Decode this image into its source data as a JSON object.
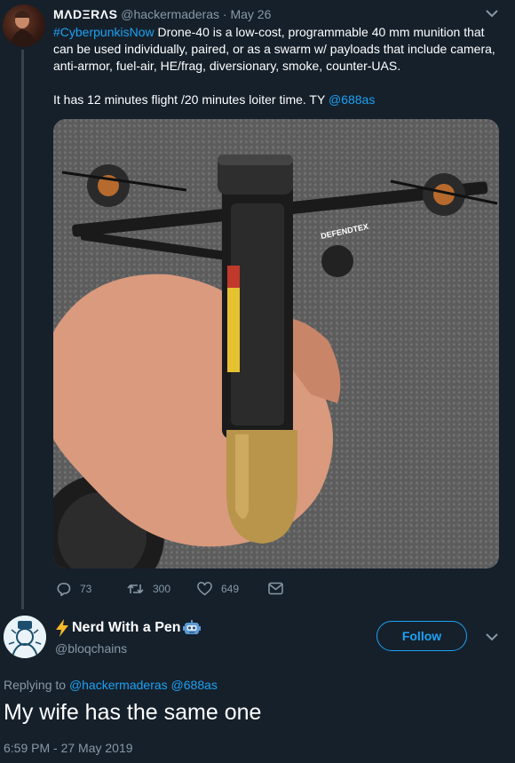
{
  "quoted_tweet": {
    "author_name": "MΛDΞRΛS",
    "handle": "@hackermaderas",
    "separator": " · ",
    "date": "May 26",
    "hashtag": "#CyberpunkisNow",
    "text_line1_rest": " Drone-40 is a low-cost, programmable 40 mm munition that can be used individually, paired, or as a swarm w/ payloads that include camera, anti-armor, fuel-air, HE/frag, diversionary, smoke, counter-UAS.",
    "text_para2": "It has 12 minutes flight /20 minutes loiter time. TY ",
    "mention": "@688as",
    "photo_brand_text": "DEFENDTEX",
    "stats": {
      "replies": "73",
      "retweets": "300",
      "likes": "649"
    }
  },
  "reply_tweet": {
    "author_name": "Nerd With a Pen",
    "handle": "@bloqchains",
    "follow_label": "Follow",
    "replying_prefix": "Replying to ",
    "replying_to_1": "@hackermaderas",
    "replying_to_2": "@688as",
    "text": "My wife has the same one",
    "timestamp": "6:59 PM - 27 May 2019"
  },
  "colors": {
    "background": "#15202b",
    "accent": "#1da1f2",
    "secondary_text": "#8899a6",
    "divider": "#38444d"
  },
  "icons": [
    "caret-down-icon",
    "reply-icon",
    "retweet-icon",
    "like-icon",
    "dm-icon",
    "lightning-emoji",
    "robot-emoji"
  ]
}
